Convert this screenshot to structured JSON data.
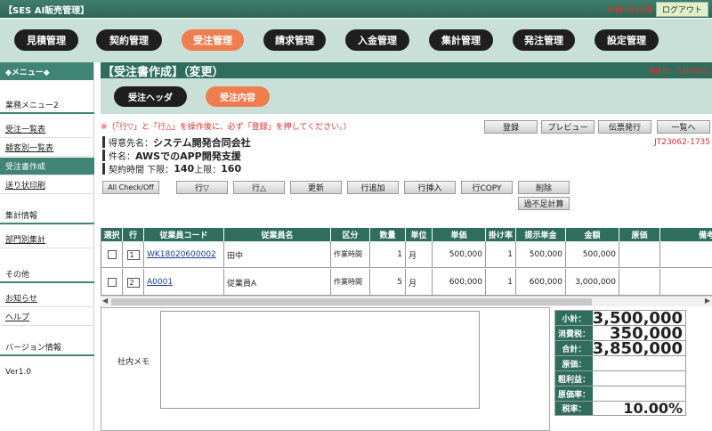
{
  "app": {
    "title": "【SES AI販売管理】",
    "user": "伊藤 日出 様",
    "logout": "ログアウト"
  },
  "nav": [
    "見積管理",
    "契約管理",
    "受注管理",
    "請求管理",
    "入金管理",
    "集計管理",
    "発注管理",
    "設定管理"
  ],
  "sidebar": {
    "header": "◆メニュー◆",
    "section_business": "業務メニュー2",
    "links": [
      "受注一覧表",
      "顧客別一覧表",
      "受注書作成",
      "送り状印刷"
    ],
    "section_stats": "集計情報",
    "stats_links": [
      "部門別集計"
    ],
    "section_other": "その他",
    "other_links": [
      "お知らせ",
      "ヘルプ"
    ],
    "section_version": "バージョン情報",
    "version": "Ver1.0"
  },
  "page": {
    "title": "【受注書作成】（変更）",
    "screen_id": "画面ID：SA00102",
    "subtabs": [
      "受注ヘッダ",
      "受注内容"
    ],
    "notice": "※（「行▽」と「行△」を操作後に、必ず「登録」を押してください。）",
    "actions": [
      "登録",
      "プレビュー",
      "伝票発行",
      "一覧へ"
    ],
    "order_no": "JT23062-1735",
    "customer_label": "得意先名：",
    "customer": "システム開発合同会社",
    "project_label": "件名：",
    "project": "AWSでのAPP開発支援",
    "contract_label": "契約時間 下限：",
    "lower": "140",
    "upper_label": " 上限：",
    "upper": "160",
    "row_buttons": [
      "All Check/Off",
      "行▽",
      "行△",
      "更新",
      "行追加",
      "行挿入",
      "行COPY",
      "削除"
    ],
    "shortage_button": "過不足計算"
  },
  "table": {
    "headers": [
      "選択",
      "行",
      "従業員コード",
      "従業員名",
      "区分",
      "数量",
      "単位",
      "単価",
      "掛け率",
      "提示単金",
      "金額",
      "原価",
      "備考"
    ],
    "rows": [
      {
        "no": "1",
        "code": "WK18020600002",
        "name": "田中",
        "kubun": "作業時間",
        "qty": "1",
        "unit": "月",
        "price": "500,000",
        "rate": "1",
        "offer": "500,000",
        "amount": "500,000",
        "cost": "",
        "note": ""
      },
      {
        "no": "2",
        "code": "A0001",
        "name": "従業員A",
        "kubun": "作業時間",
        "qty": "5",
        "unit": "月",
        "price": "600,000",
        "rate": "1",
        "offer": "600,000",
        "amount": "3,000,000",
        "cost": "",
        "note": ""
      }
    ]
  },
  "memo": {
    "label": "社内メモ",
    "value": ""
  },
  "summary": [
    {
      "label": "小計：",
      "value": "3,500,000"
    },
    {
      "label": "消費税：",
      "value": "350,000"
    },
    {
      "label": "合計：",
      "value": "3,850,000"
    },
    {
      "label": "原価：",
      "value": ""
    },
    {
      "label": "粗利益：",
      "value": ""
    },
    {
      "label": "原価率：",
      "value": ""
    },
    {
      "label": "税率：",
      "value": "10.00%"
    }
  ],
  "colors": {
    "header": "#2f6e5c",
    "nav_bg": "#c9e0d9",
    "active": "#ef7e4e",
    "alert": "#e03030"
  }
}
